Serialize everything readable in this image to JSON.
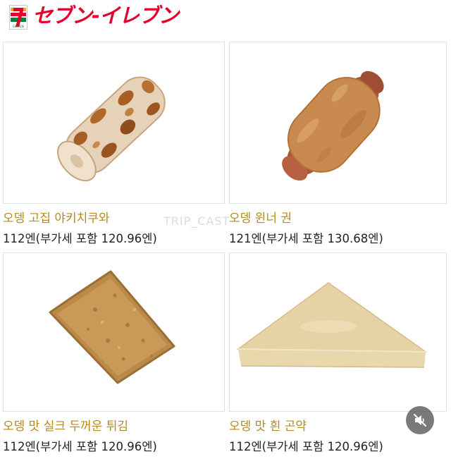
{
  "brand": {
    "logo_number": "7",
    "logo_word": "ELEVEN",
    "name": "セブン-イレブン"
  },
  "watermark": "TRIP_CAST",
  "products": [
    {
      "name": "오뎅 고집 야키치쿠와",
      "price": "112엔(부가세 포함 120.96엔)",
      "image_icon": "yaki-chikuwa-image"
    },
    {
      "name": "오뎅 윈너 권",
      "price": "121엔(부가세 포함 130.68엔)",
      "image_icon": "wiener-roll-image"
    },
    {
      "name": "오뎅 맛 실크 두꺼운 튀김",
      "price": "112엔(부가세 포함 120.96엔)",
      "image_icon": "atsuage-image"
    },
    {
      "name": "오뎅 맛 흰 곤약",
      "price": "112엔(부가세 포함 120.96엔)",
      "image_icon": "konjac-image"
    }
  ],
  "controls": {
    "mute_icon": "speaker-muted-icon"
  },
  "colors": {
    "brand_red": "#e4002b",
    "name_text": "#b58a1e",
    "price_text": "#222222"
  }
}
